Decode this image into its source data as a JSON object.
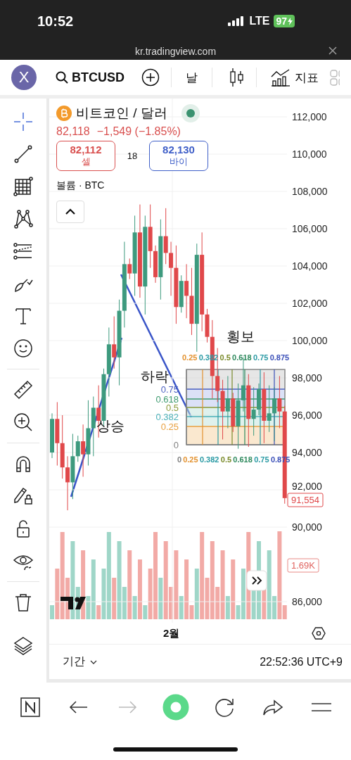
{
  "status_bar": {
    "time": "10:52",
    "network": "LTE",
    "battery": "97"
  },
  "browser": {
    "url": "kr.tradingview.com"
  },
  "toolbar": {
    "avatar": "X",
    "symbol": "BTCUSD",
    "interval": "날",
    "indicators": "지표"
  },
  "tools": [
    {
      "kind": "crosshair",
      "selected": true
    },
    {
      "kind": "trendline",
      "selected": false
    },
    {
      "kind": "gann",
      "selected": false
    },
    {
      "kind": "pattern",
      "selected": false
    },
    {
      "kind": "fib",
      "selected": false
    },
    {
      "kind": "brush",
      "selected": false
    },
    {
      "kind": "text",
      "selected": false
    },
    {
      "kind": "smile",
      "selected": false
    },
    {
      "kind": "ruler",
      "selected": false
    },
    {
      "kind": "zoom",
      "selected": false
    },
    {
      "kind": "magnet",
      "selected": false
    },
    {
      "kind": "pencil-lock",
      "selected": false
    },
    {
      "kind": "unlock",
      "selected": false
    },
    {
      "kind": "eye",
      "selected": false
    },
    {
      "kind": "trash",
      "selected": false
    },
    {
      "kind": "layers",
      "selected": false
    }
  ],
  "legend": {
    "title": "비트코인 / 달러",
    "market_open": true,
    "price": "82,118",
    "change": "−1,549 (−1.85%)",
    "sell": {
      "price": "82,112",
      "label": "셀"
    },
    "spread": "18",
    "buy": {
      "price": "82,130",
      "label": "바이"
    },
    "volume": "볼륨 · BTC"
  },
  "chart": {
    "chart_data": {
      "type": "candlestick",
      "ylim": [
        85000,
        113000
      ],
      "grid": true,
      "yticks": [
        {
          "value": 112000,
          "label": "112,000"
        },
        {
          "value": 110000,
          "label": "110,000"
        },
        {
          "value": 108000,
          "label": "108,000"
        },
        {
          "value": 106000,
          "label": "106,000"
        },
        {
          "value": 104000,
          "label": "104,000"
        },
        {
          "value": 102000,
          "label": "102,000"
        },
        {
          "value": 100000,
          "label": "100,000"
        },
        {
          "value": 98000,
          "label": "98,000"
        },
        {
          "value": 96000,
          "label": "96,000"
        },
        {
          "value": 94000,
          "label": "94,000"
        },
        {
          "value": 92000,
          "label": "92,000"
        },
        {
          "value": 90000,
          "label": "90,000"
        },
        {
          "value": 86000,
          "label": "86,000"
        }
      ],
      "ohlc": [
        [
          94000,
          96100,
          93700,
          95800
        ],
        [
          95800,
          96700,
          93300,
          94500
        ],
        [
          94500,
          96000,
          92600,
          93200
        ],
        [
          93200,
          93800,
          90900,
          92400
        ],
        [
          92400,
          95000,
          91500,
          93800
        ],
        [
          93800,
          94900,
          93500,
          94600
        ],
        [
          94600,
          95500,
          92700,
          93900
        ],
        [
          93900,
          96800,
          93300,
          95300
        ],
        [
          95300,
          97000,
          93800,
          96400
        ],
        [
          96400,
          97600,
          94800,
          95700
        ],
        [
          95700,
          98500,
          95400,
          98200
        ],
        [
          98200,
          100700,
          97000,
          99800
        ],
        [
          99800,
          101300,
          98500,
          99100
        ],
        [
          99100,
          102200,
          97600,
          101600
        ],
        [
          101600,
          105300,
          100700,
          104100
        ],
        [
          104100,
          104400,
          103300,
          103600
        ],
        [
          103600,
          106700,
          102400,
          105800
        ],
        [
          105800,
          107300,
          102300,
          102900
        ],
        [
          102900,
          106700,
          101400,
          106100
        ],
        [
          106100,
          107300,
          103900,
          104800
        ],
        [
          104800,
          105100,
          103100,
          103400
        ],
        [
          103400,
          106500,
          102200,
          105600
        ],
        [
          105600,
          107100,
          104100,
          104700
        ],
        [
          104700,
          105300,
          102400,
          103900
        ],
        [
          103900,
          105100,
          100900,
          101800
        ],
        [
          101800,
          103500,
          101500,
          103200
        ],
        [
          103200,
          104100,
          101200,
          102400
        ],
        [
          102400,
          103900,
          100300,
          100900
        ],
        [
          100900,
          105200,
          99400,
          104600
        ],
        [
          104600,
          105800,
          100500,
          101400
        ],
        [
          101400,
          101700,
          99900,
          100200
        ],
        [
          100200,
          101100,
          96900,
          98100
        ],
        [
          98100,
          99600,
          96700,
          97300
        ],
        [
          97300,
          97900,
          94700,
          96200
        ],
        [
          96200,
          98100,
          95300,
          96900
        ],
        [
          96900,
          97200,
          95100,
          95400
        ],
        [
          95400,
          97700,
          94200,
          96800
        ],
        [
          96800,
          99100,
          96200,
          97600
        ],
        [
          97600,
          98200,
          94300,
          95800
        ],
        [
          95800,
          97500,
          94900,
          96300
        ],
        [
          96300,
          97700,
          96000,
          97400
        ],
        [
          97400,
          98300,
          94500,
          95700
        ],
        [
          95700,
          97600,
          95100,
          96100
        ],
        [
          96100,
          97500,
          94600,
          96900
        ],
        [
          96900,
          98100,
          95300,
          96200
        ],
        [
          96200,
          96500,
          91254,
          91554
        ]
      ]
    },
    "last_price": "91,554",
    "last_volume": "1.69K"
  },
  "drawings": {
    "up": "상승",
    "down": "하락",
    "sideways": "횡보"
  },
  "fib": {
    "levels": [
      {
        "label": "0.75",
        "color": "#4a5fc1"
      },
      {
        "label": "0.618",
        "color": "#3d9a6e"
      },
      {
        "label": "0.5",
        "color": "#8a9a3a"
      },
      {
        "label": "0.382",
        "color": "#4ab0b8"
      },
      {
        "label": "0.25",
        "color": "#e8a040"
      },
      {
        "label": "0",
        "color": "#808080"
      }
    ],
    "time_levels_top": [
      {
        "label": "0.25",
        "color": "#e39230"
      },
      {
        "label": "0.382",
        "color": "#2a9aa4"
      },
      {
        "label": "0.5",
        "color": "#7a8a2a"
      },
      {
        "label": "0.618",
        "color": "#2f8a5e"
      },
      {
        "label": "0.75",
        "color": "#2a9aa4"
      },
      {
        "label": "0.875",
        "color": "#3a4fb8"
      }
    ],
    "time_levels_bottom": [
      {
        "label": "0",
        "color": "#808080"
      },
      {
        "label": "0.25",
        "color": "#e39230"
      },
      {
        "label": "0.382",
        "color": "#2a9aa4"
      },
      {
        "label": "0.5",
        "color": "#7a8a2a"
      },
      {
        "label": "0.618",
        "color": "#2f8a5e"
      },
      {
        "label": "0.75",
        "color": "#2a9aa4"
      },
      {
        "label": "0.875",
        "color": "#3a4fb8"
      }
    ]
  },
  "time_axis": {
    "label": "2월"
  },
  "footer": {
    "range": "기간",
    "clock": "22:52:36 UTC+9"
  },
  "nav": [
    {
      "kind": "notes",
      "disabled": false
    },
    {
      "kind": "back",
      "disabled": false
    },
    {
      "kind": "forward",
      "disabled": true
    },
    {
      "kind": "home",
      "disabled": false
    },
    {
      "kind": "reload",
      "disabled": false
    },
    {
      "kind": "share",
      "disabled": false
    },
    {
      "kind": "menu",
      "disabled": false
    }
  ]
}
